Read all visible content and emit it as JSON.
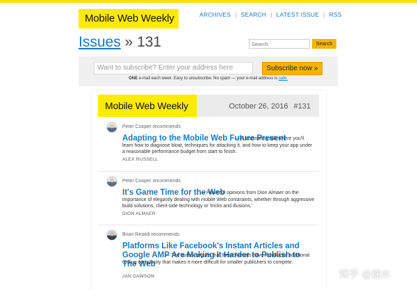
{
  "brand": {
    "logo_text": "Mobile Web Weekly",
    "accent": "#ffeb00",
    "link_color": "#1a78c2",
    "button_color": "#f6b300"
  },
  "nav": {
    "items": [
      "ARCHIVES",
      "SEARCH",
      "LATEST ISSUE",
      "RSS"
    ]
  },
  "header": {
    "issues_link": "Issues",
    "separator": "»",
    "issue_number": "131"
  },
  "search": {
    "placeholder": "Search",
    "button_label": "Search"
  },
  "subscribe": {
    "placeholder": "Want to subscribe? Enter your address here",
    "button_label": "Subscribe now »",
    "note_bold": "ONE",
    "note_text": " e-mail each week. Easy to unsubscribe. No spam — your e-mail address is ",
    "note_link": "safe."
  },
  "issue": {
    "logo_text": "Mobile Web Weekly",
    "date": "October 26, 2016",
    "number": "#131"
  },
  "articles": [
    {
      "recommender": "Peter Cooper recommends",
      "title": "Adapting to the Mobile Web Future Present",
      "description": "— A fascinating talk where you'll learn how to diagnose bloat, techniques for attacking it, and how to keep your app under a reasonable performance budget from start to finish.",
      "author": "ALEX RUSSELL"
    },
    {
      "recommender": "Peter Cooper recommends",
      "title": "It's Game Time for the Web",
      "description": "— Powerful opinions from Dion Almaer on the importance of elegantly dealing with mobile Web constraints, whether through aggressive build solutions, client-side technology or 'tricks and illusions.'",
      "author": "DION ALMAER"
    },
    {
      "recommender": "Brian Rinaldi recommends",
      "title": "Platforms Like Facebook's Instant Articles and Google AMP Are Making It Harder to Publish to The Web",
      "description": "— The author argues that these formats have introduced additional coding complexity that makes it more difficult for smaller publishers to compete.",
      "author": "JAN DAWSON"
    }
  ],
  "watermark": "知乎 @速水"
}
